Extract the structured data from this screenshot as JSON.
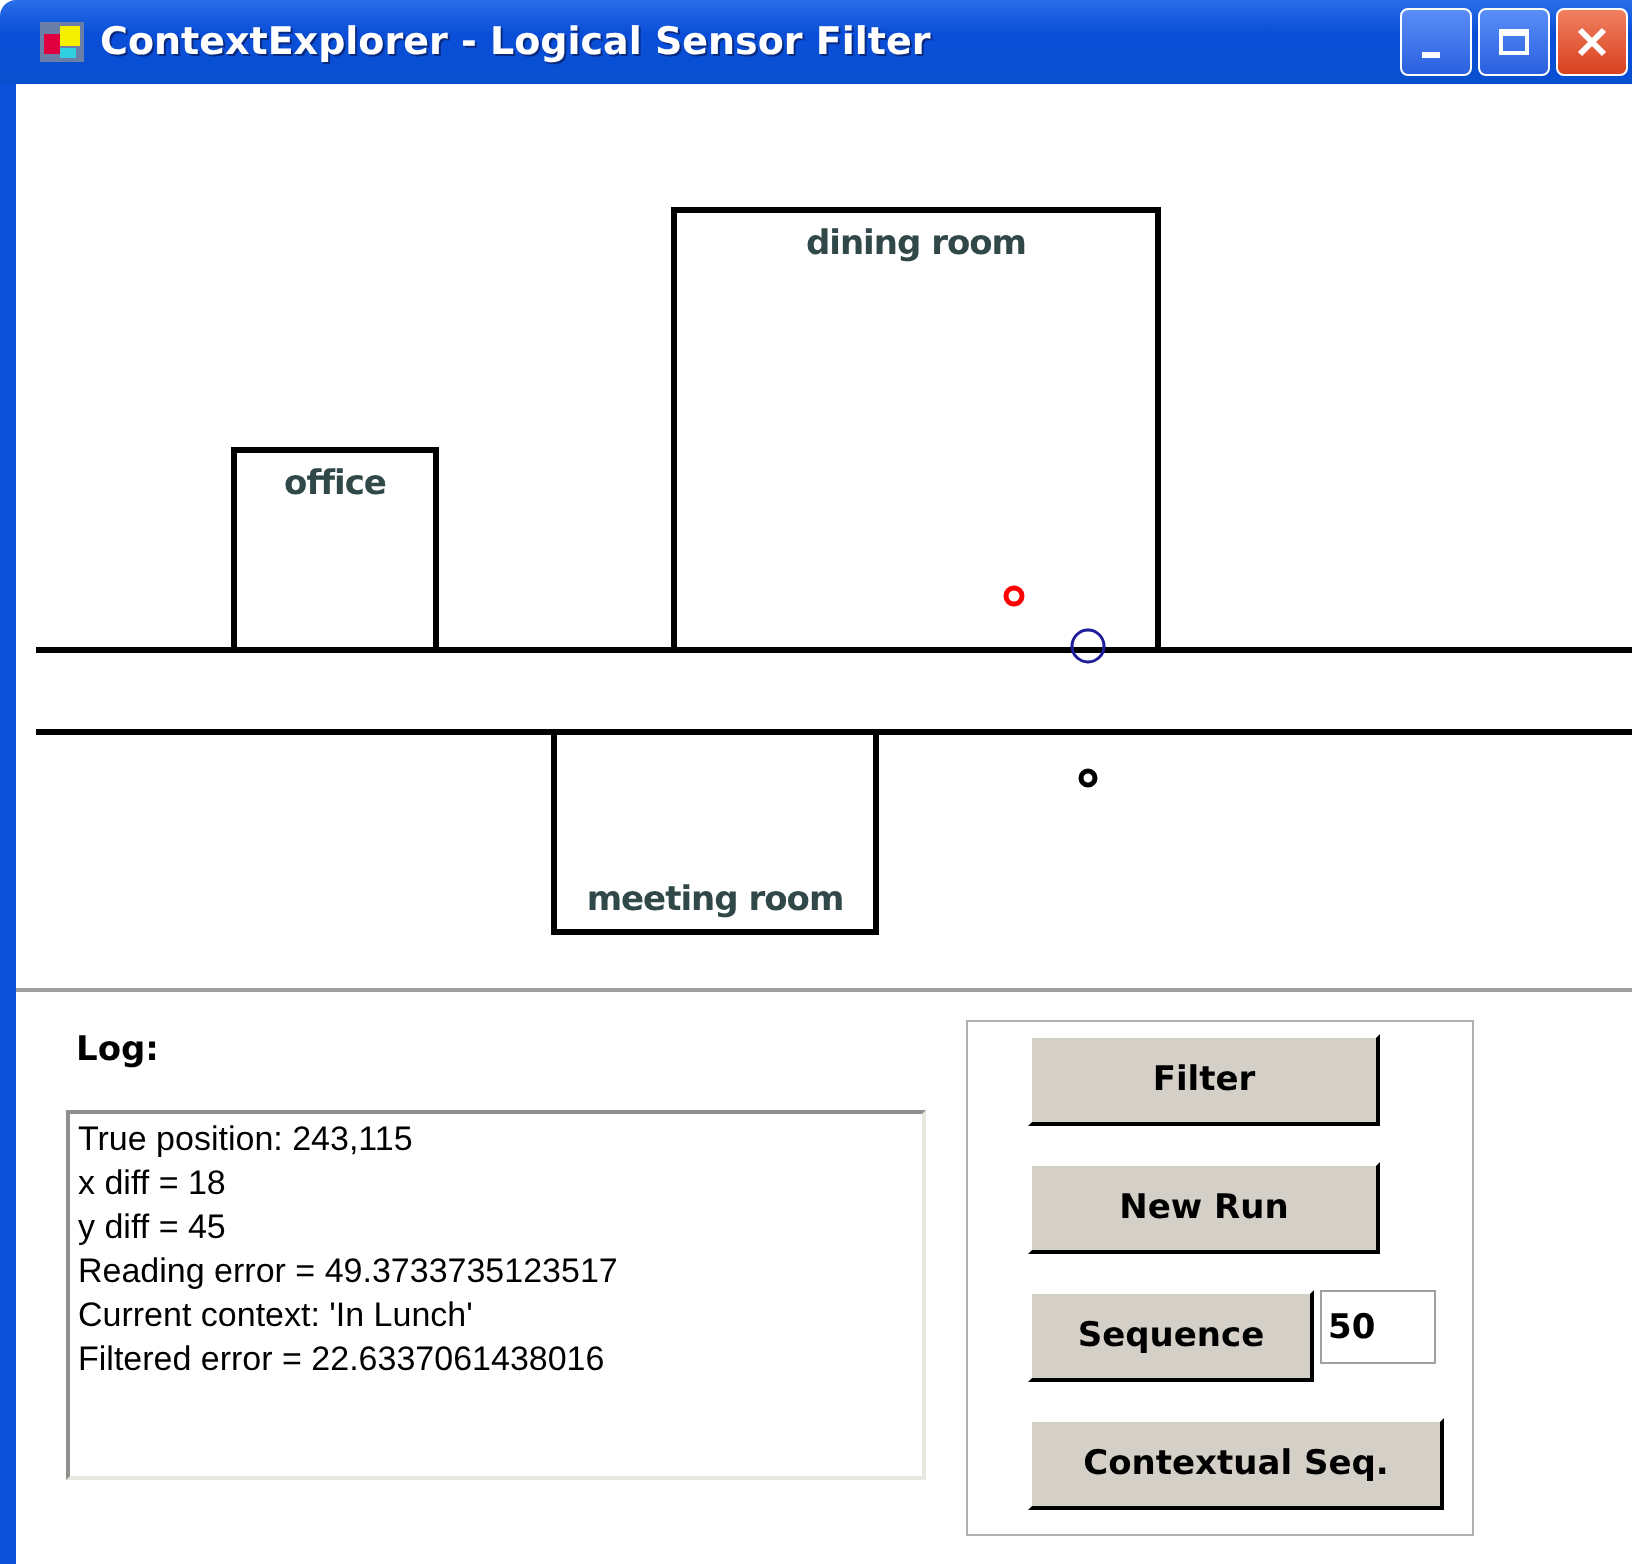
{
  "window": {
    "title": "ContextExplorer - Logical Sensor Filter"
  },
  "map": {
    "rooms": [
      {
        "name": "office"
      },
      {
        "name": "dining room"
      },
      {
        "name": "meeting room"
      }
    ],
    "markers": [
      {
        "color": "#ff0000"
      },
      {
        "color": "#1c1c9c"
      },
      {
        "color": "#000000"
      }
    ]
  },
  "log": {
    "label": "Log:",
    "lines": [
      "True position: 243,115",
      "x diff = 18",
      "y diff = 45",
      "Reading error = 49.3733735123517",
      "Current context: 'In Lunch'",
      "Filtered error = 22.6337061438016"
    ]
  },
  "controls": {
    "filter_button": "Filter",
    "new_run_button": "New Run",
    "sequence_button": "Sequence",
    "sequence_value": "50",
    "contextual_button": "Contextual Seq."
  }
}
